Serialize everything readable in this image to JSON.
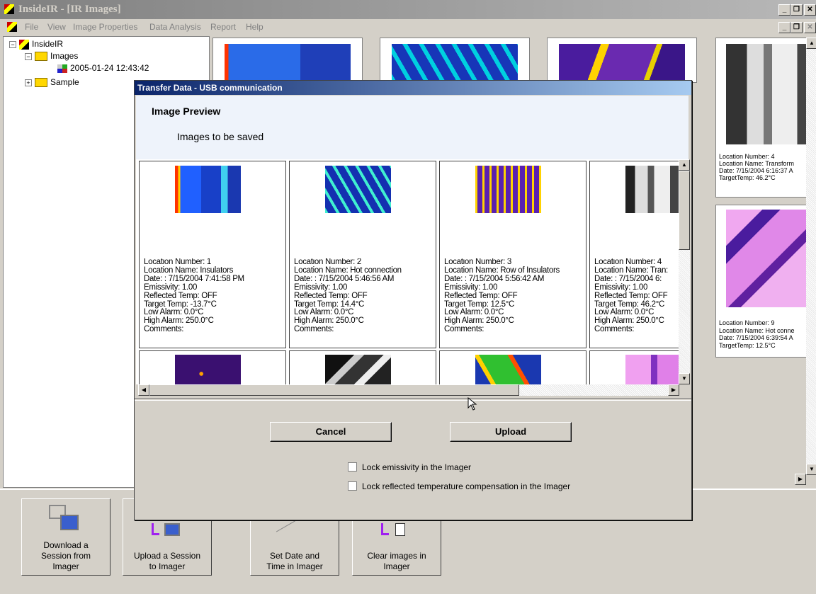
{
  "app": {
    "title": "InsideIR - [IR Images]",
    "menu": [
      "File",
      "View",
      "Image Properties",
      "Data Analysis",
      "Report",
      "Help"
    ]
  },
  "tree": {
    "root": "InsideIR",
    "images_folder": "Images",
    "session": "2005-01-24 12:43:42",
    "sample_folder": "Sample"
  },
  "background_cards": [
    {
      "location_number": "Location Number: 4",
      "location_name": "Location Name: Transform",
      "date": "Date: 7/15/2004 6:16:37 A",
      "target_temp": "TargetTemp: 46.2°C"
    },
    {
      "location_number": "Location Number: 9",
      "location_name": "Location Name: Hot conne",
      "date": "Date: 7/15/2004 6:39:54 A",
      "target_temp": "TargetTemp: 12.5°C"
    }
  ],
  "dialog": {
    "title": "Transfer Data - USB communication",
    "header": "Image Preview",
    "subheader": "Images to be saved",
    "cancel_label": "Cancel",
    "upload_label": "Upload",
    "lock_emissivity": "Lock emissivity in the Imager",
    "lock_reflected": "Lock reflected temperature compensation in the Imager",
    "cards": [
      {
        "lines": [
          "Location Number: 1",
          "Location Name: Insulators",
          "Date: : 7/15/2004 7:41:58 PM",
          "Emissivity: 1.00",
          "Reflected Temp: OFF",
          "Target Temp: -13.7°C",
          "Low Alarm: 0.0°C",
          "High Alarm: 250.0°C",
          "Comments:"
        ]
      },
      {
        "lines": [
          "Location Number: 2",
          "Location Name: Hot connection",
          "Date: : 7/15/2004 5:46:56 AM",
          "Emissivity: 1.00",
          "Reflected Temp: OFF",
          "Target Temp: 14.4°C",
          "Low Alarm: 0.0°C",
          "High Alarm: 250.0°C",
          "Comments:"
        ]
      },
      {
        "lines": [
          "Location Number: 3",
          "Location Name: Row of Insulators",
          "Date: : 7/15/2004 5:56:42 AM",
          "Emissivity: 1.00",
          "Reflected Temp: OFF",
          "Target Temp: 12.5°C",
          "Low Alarm: 0.0°C",
          "High Alarm: 250.0°C",
          "Comments:"
        ]
      },
      {
        "lines": [
          "Location Number: 4",
          "Location Name: Tran:",
          "Date: : 7/15/2004 6:",
          "Emissivity: 1.00",
          "Reflected Temp: OFF",
          "Target Temp: 46.2°C",
          "Low Alarm: 0.0°C",
          "High Alarm: 250.0°C",
          "Comments:"
        ]
      }
    ]
  },
  "bottom_buttons": [
    {
      "label_1": "Download a",
      "label_2": "Session from",
      "label_3": "Imager"
    },
    {
      "label_1": "Upload a Session",
      "label_2": "to Imager"
    },
    {
      "label_1": "Set Date and",
      "label_2": "Time in Imager"
    },
    {
      "label_1": "Clear images in",
      "label_2": "Imager"
    }
  ]
}
